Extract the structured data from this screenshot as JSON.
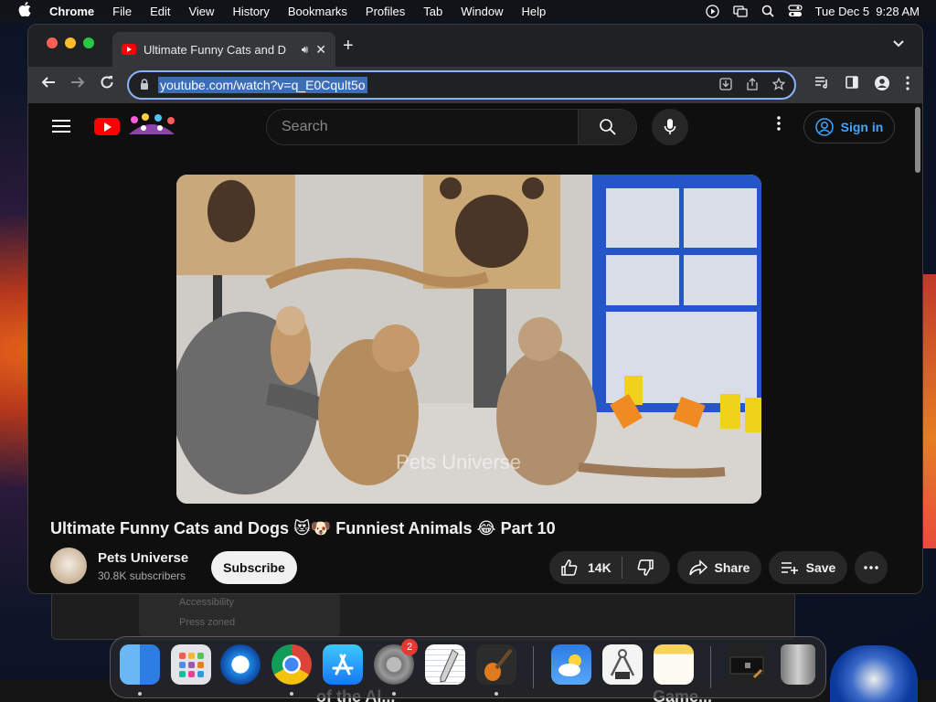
{
  "menubar": {
    "app": "Chrome",
    "items": [
      "File",
      "Edit",
      "View",
      "History",
      "Bookmarks",
      "Profiles",
      "Tab",
      "Window",
      "Help"
    ],
    "datetime": "Tue Dec 5  9:28 AM"
  },
  "browser": {
    "tab_title": "Ultimate Funny Cats and D",
    "url": "youtube.com/watch?v=q_E0Cqult5o"
  },
  "youtube": {
    "search_placeholder": "Search",
    "sign_in": "Sign in",
    "video_title": "Ultimate Funny Cats and Dogs 😻🐶 Funniest Animals 😂 Part 10",
    "watermark": "Pets Universe",
    "channel_name": "Pets Universe",
    "subscribers": "30.8K subscribers",
    "subscribe_label": "Subscribe",
    "likes": "14K",
    "share_label": "Share",
    "save_label": "Save"
  },
  "background": {
    "panel_lines": [
      "Accessibility",
      "Press zoned"
    ],
    "strip_left": "of the Al...",
    "strip_right": "Game..."
  },
  "dock": {
    "apps": [
      "Finder",
      "Launchpad",
      "Safari",
      "Chrome",
      "App Store",
      "System Settings",
      "TextEdit",
      "GarageBand",
      "Weather",
      "Instruments",
      "Notes",
      "Screenshot",
      "Trash"
    ],
    "settings_badge": "2"
  },
  "colors": {
    "yt_red": "#ff0000",
    "link_blue": "#3ea6ff",
    "omnibox_focus": "#8ab4f8"
  }
}
